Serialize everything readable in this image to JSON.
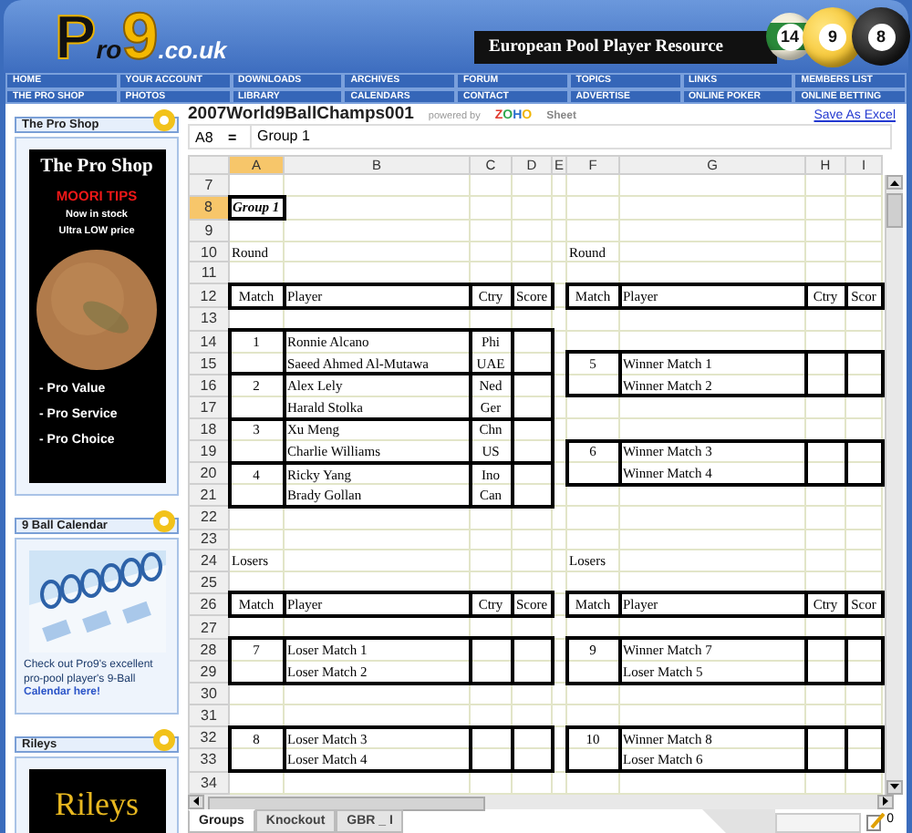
{
  "header": {
    "logo": {
      "initial": "P",
      "rest": "ro",
      "number": "9",
      "domain": ".co.uk"
    },
    "tagline": "European Pool Player Resource",
    "balls": [
      {
        "number": "14",
        "kind": "stripe"
      },
      {
        "number": "9",
        "kind": "nine"
      },
      {
        "number": "8",
        "kind": "eight"
      }
    ]
  },
  "nav": [
    [
      "HOME",
      "YOUR ACCOUNT",
      "DOWNLOADS",
      "ARCHIVES",
      "FORUM",
      "TOPICS",
      "LINKS",
      "MEMBERS LIST"
    ],
    [
      "THE PRO SHOP",
      "PHOTOS",
      "LIBRARY",
      "CALENDARS",
      "CONTACT",
      "ADVERTISE",
      "ONLINE POKER",
      "ONLINE BETTING"
    ]
  ],
  "sidebar": {
    "pro_shop": {
      "title": "The Pro Shop",
      "heading": "The Pro Shop",
      "promo": "MOORI TIPS",
      "stock": "Now in stock",
      "price": "Ultra LOW price",
      "bullets": [
        "- Pro Value",
        "- Pro Service",
        "- Pro Choice"
      ]
    },
    "calendar": {
      "title": "9 Ball Calendar",
      "text": "Check out Pro9's excellent pro-pool player's 9-Ball ",
      "link": "Calendar here!"
    },
    "rileys": {
      "title": "Rileys",
      "logo": "Rileys"
    }
  },
  "sheet": {
    "title": "2007World9BallChamps001",
    "powered_by": "powered by",
    "brand": "ZOHO",
    "product": "Sheet",
    "save_link": "Save As Excel",
    "cell_ref": "A8",
    "equals": "=",
    "formula": "Group 1",
    "columns": [
      {
        "label": "A",
        "selected": true
      },
      {
        "label": "B",
        "selected": false
      },
      {
        "label": "C",
        "selected": false
      },
      {
        "label": "D",
        "selected": false
      },
      {
        "label": "E",
        "selected": false
      },
      {
        "label": "F",
        "selected": false
      },
      {
        "label": "G",
        "selected": false
      },
      {
        "label": "H",
        "selected": false
      },
      {
        "label": "I",
        "selected": false
      }
    ],
    "rows": [
      {
        "num": "7",
        "selected": false
      },
      {
        "num": "8",
        "selected": true,
        "left": {
          "label": "Group 1"
        }
      },
      {
        "num": "9",
        "selected": false
      },
      {
        "num": "10",
        "selected": false,
        "left": {
          "label": "Round"
        },
        "right": {
          "label": "Round"
        }
      },
      {
        "num": "11",
        "selected": false
      },
      {
        "num": "12",
        "selected": false,
        "left": {
          "match": "Match",
          "player": "Player",
          "ctry": "Ctry",
          "score": "Score",
          "kind": "single"
        },
        "right": {
          "match": "Match",
          "player": "Player",
          "ctry": "Ctry",
          "score": "Scor",
          "kind": "single"
        }
      },
      {
        "num": "13",
        "selected": false
      },
      {
        "num": "14",
        "selected": false,
        "left": {
          "match": "1",
          "player": "Ronnie Alcano",
          "ctry": "Phi",
          "kind": "top"
        }
      },
      {
        "num": "15",
        "selected": false,
        "left": {
          "player": "Saeed Ahmed Al-Mutawa",
          "ctry": "UAE",
          "kind": "bottom"
        },
        "right": {
          "match": "5",
          "player": "Winner Match 1",
          "kind": "top"
        }
      },
      {
        "num": "16",
        "selected": false,
        "left": {
          "match": "2",
          "player": "Alex Lely",
          "ctry": "Ned",
          "kind": "top"
        },
        "right": {
          "player": "Winner Match 2",
          "kind": "bottom"
        }
      },
      {
        "num": "17",
        "selected": false,
        "left": {
          "player": "Harald Stolka",
          "ctry": "Ger",
          "kind": "bottom"
        }
      },
      {
        "num": "18",
        "selected": false,
        "left": {
          "match": "3",
          "player": "Xu Meng",
          "ctry": "Chn",
          "kind": "top"
        }
      },
      {
        "num": "19",
        "selected": false,
        "left": {
          "player": "Charlie Williams",
          "ctry": "US",
          "kind": "bottom"
        },
        "right": {
          "match": "6",
          "player": "Winner Match 3",
          "kind": "top"
        }
      },
      {
        "num": "20",
        "selected": false,
        "left": {
          "match": "4",
          "player": "Ricky Yang",
          "ctry": "Ino",
          "kind": "top"
        },
        "right": {
          "player": "Winner Match 4",
          "kind": "bottom"
        }
      },
      {
        "num": "21",
        "selected": false,
        "left": {
          "player": "Brady Gollan",
          "ctry": "Can",
          "kind": "bottom"
        }
      },
      {
        "num": "22",
        "selected": false
      },
      {
        "num": "23",
        "selected": false
      },
      {
        "num": "24",
        "selected": false,
        "left": {
          "label": "Losers"
        },
        "right": {
          "label": "Losers"
        }
      },
      {
        "num": "25",
        "selected": false
      },
      {
        "num": "26",
        "selected": false,
        "left": {
          "match": "Match",
          "player": "Player",
          "ctry": "Ctry",
          "score": "Score",
          "kind": "single"
        },
        "right": {
          "match": "Match",
          "player": "Player",
          "ctry": "Ctry",
          "score": "Scor",
          "kind": "single"
        }
      },
      {
        "num": "27",
        "selected": false
      },
      {
        "num": "28",
        "selected": false,
        "left": {
          "match": "7",
          "player": "Loser Match 1",
          "kind": "top"
        },
        "right": {
          "match": "9",
          "player": "Winner Match 7",
          "kind": "top"
        }
      },
      {
        "num": "29",
        "selected": false,
        "left": {
          "player": "Loser Match 2",
          "kind": "bottom"
        },
        "right": {
          "player": "Loser Match 5",
          "kind": "bottom"
        }
      },
      {
        "num": "30",
        "selected": false
      },
      {
        "num": "31",
        "selected": false
      },
      {
        "num": "32",
        "selected": false,
        "left": {
          "match": "8",
          "player": "Loser Match 3",
          "kind": "top"
        },
        "right": {
          "match": "10",
          "player": "Winner Match 8",
          "kind": "top"
        }
      },
      {
        "num": "33",
        "selected": false,
        "left": {
          "player": "Loser Match 4",
          "kind": "bottom"
        },
        "right": {
          "player": "Loser Match 6",
          "kind": "bottom"
        }
      },
      {
        "num": "34",
        "selected": false
      }
    ],
    "tabs": [
      {
        "label": "Groups",
        "selected": true
      },
      {
        "label": "Knockout",
        "selected": false
      },
      {
        "label": "GBR _ I",
        "selected": false
      }
    ],
    "note_count": "0"
  }
}
